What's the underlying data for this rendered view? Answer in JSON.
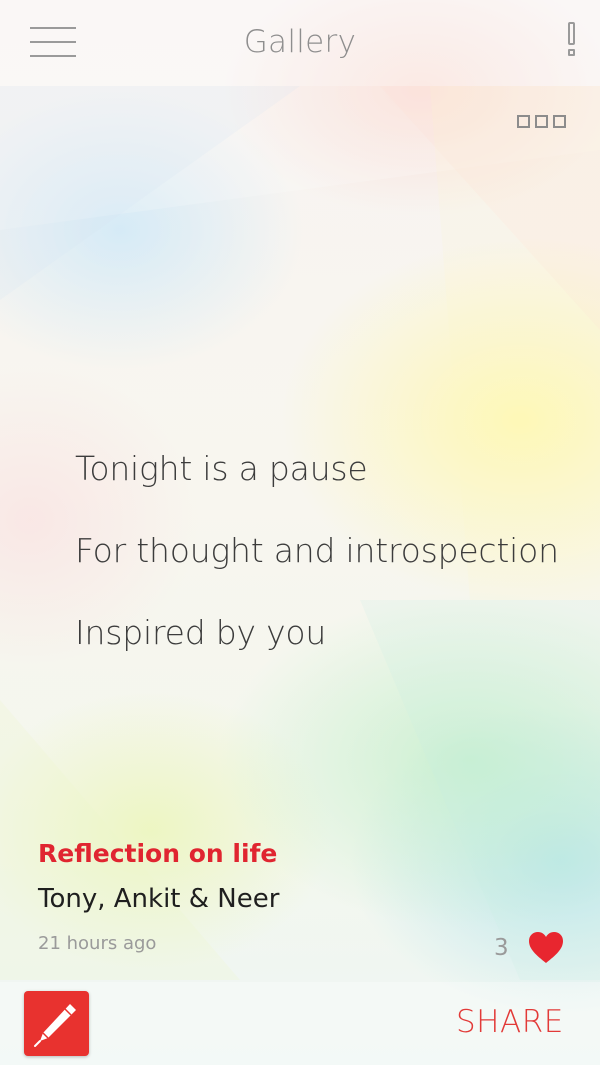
{
  "header": {
    "title": "Gallery",
    "menu_icon": "hamburger-menu-icon",
    "alert_icon": "exclamation-icon"
  },
  "options": {
    "icon": "more-options-icon"
  },
  "poem": {
    "lines": [
      "Tonight is a pause",
      "For thought and introspection",
      "Inspired by you"
    ]
  },
  "post": {
    "title": "Reflection on life",
    "authors": "Tony, Ankit & Neer",
    "timestamp": "21 hours ago",
    "likes": "3",
    "like_icon": "heart-icon"
  },
  "footer": {
    "compose_icon": "pen-icon",
    "share_label": "SHARE"
  },
  "colors": {
    "accent": "#e02530",
    "compose_bg": "#e8322f",
    "heart": "#e8262f"
  }
}
